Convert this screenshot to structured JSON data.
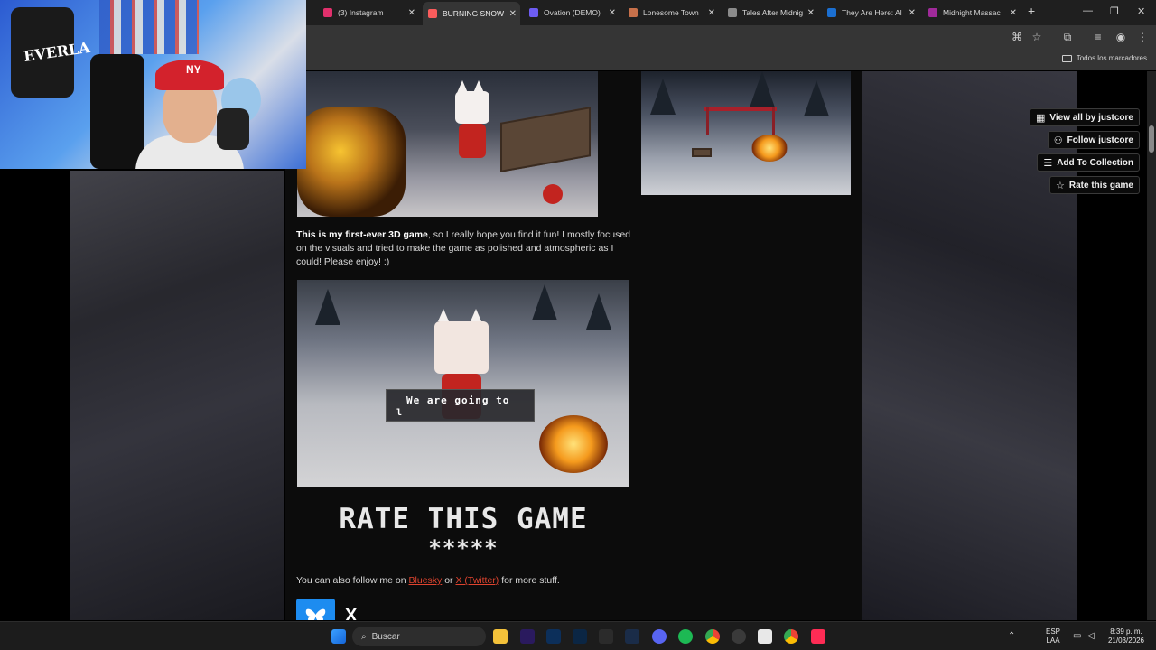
{
  "browser": {
    "tabs": [
      {
        "title": "(3) Instagram",
        "color": "#e1306c",
        "active": false
      },
      {
        "title": "BURNING SNOW",
        "color": "#fa5c5c",
        "active": true
      },
      {
        "title": "Ovation (DEMO)",
        "color": "#6d5cf2",
        "active": false
      },
      {
        "title": "Lonesome Town",
        "color": "#c7704a",
        "active": false
      },
      {
        "title": "Tales After Midnig",
        "color": "#8b8b8b",
        "active": false
      },
      {
        "title": "They Are Here: Al",
        "color": "#1b6fd1",
        "active": false
      },
      {
        "title": "Midnight Massac",
        "color": "#a02a9a",
        "active": false
      }
    ],
    "new_tab": "+",
    "bookmarks_folder": "Todos los marcadores"
  },
  "side_actions": [
    {
      "label": "View all by justcore",
      "icon": "grid-icon"
    },
    {
      "label": "Follow justcore",
      "icon": "user-plus-icon"
    },
    {
      "label": "Add To Collection",
      "icon": "list-plus-icon"
    },
    {
      "label": "Rate this game",
      "icon": "star-icon"
    }
  ],
  "content": {
    "desc_bold": "This is my first-ever 3D game",
    "desc_rest": ", so I really hope you find it fun! I mostly focused on the visuals and tried to make the game as polished and atmospheric as I could! Please enjoy! :)",
    "dialog_text": "We are going to",
    "dialog_cursor": "l",
    "rate_title": "RATE THIS GAME",
    "rate_stars": "*****",
    "follow_prefix": "You can also follow me on ",
    "follow_bluesky": "Bluesky",
    "follow_or": " or ",
    "follow_x": "X (Twitter)",
    "follow_suffix": " for more stuff.",
    "x_logo": "X"
  },
  "webcam": {
    "bag_text": "EVERLA",
    "cap_logo": "NY"
  },
  "taskbar": {
    "search_placeholder": "Buscar",
    "lang_top": "ESP",
    "lang_bottom": "LAA",
    "time": "8:39 p. m.",
    "date": "21/03/2026"
  },
  "colors": {
    "link": "#e0442f",
    "bluesky": "#1d8cf0"
  }
}
